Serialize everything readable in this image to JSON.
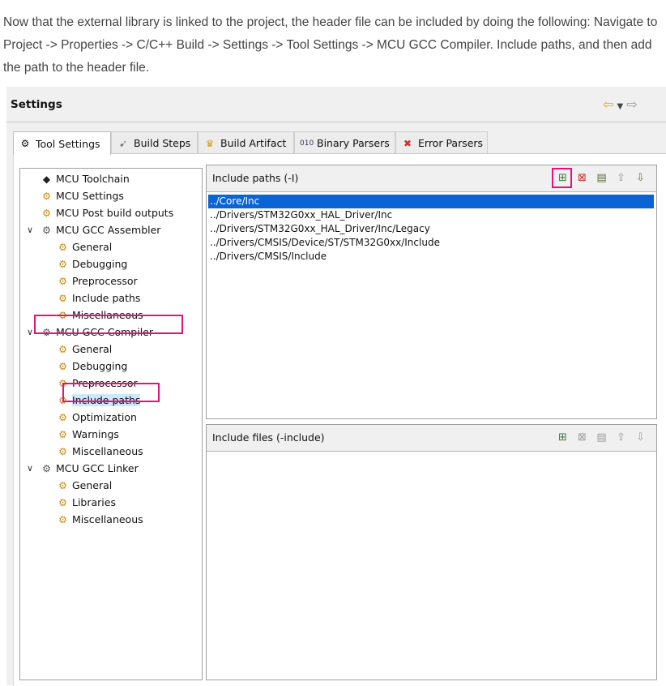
{
  "intro": "Now that the external library is linked to the project, the header file can be included by doing the following: Navigate to Project -> Properties -> C/C++ Build -> Settings -> Tool Settings -> MCU GCC Compiler. Include paths, and then add the path to the header file.",
  "settings": {
    "title": "Settings",
    "nav": {
      "back_icon": "back-arrow-icon",
      "dropdown_icon": "chevron-down-icon",
      "forward_icon": "forward-arrow-icon"
    }
  },
  "tabs": [
    {
      "label": "Tool Settings",
      "icon": "tool-settings-gear-icon",
      "active": true
    },
    {
      "label": "Build Steps",
      "icon": "build-steps-icon"
    },
    {
      "label": "Build Artifact",
      "icon": "trophy-icon"
    },
    {
      "label": "Binary Parsers",
      "icon": "binary-icon"
    },
    {
      "label": "Error Parsers",
      "icon": "error-icon"
    }
  ],
  "tree": {
    "mcu_toolchain": "MCU Toolchain",
    "mcu_settings": "MCU Settings",
    "mcu_post_build": "MCU Post build outputs",
    "assembler": {
      "label": "MCU GCC Assembler",
      "children": [
        "General",
        "Debugging",
        "Preprocessor",
        "Include paths",
        "Miscellaneous"
      ]
    },
    "compiler": {
      "label": "MCU GCC Compiler",
      "children": [
        "General",
        "Debugging",
        "Preprocessor",
        "Include paths",
        "Optimization",
        "Warnings",
        "Miscellaneous"
      ],
      "selected": "Include paths"
    },
    "linker": {
      "label": "MCU GCC Linker",
      "children": [
        "General",
        "Libraries",
        "Miscellaneous"
      ]
    }
  },
  "include_paths": {
    "title": "Include paths (-I)",
    "items": [
      "../Core/Inc",
      "../Drivers/STM32G0xx_HAL_Driver/Inc",
      "../Drivers/STM32G0xx_HAL_Driver/Inc/Legacy",
      "../Drivers/CMSIS/Device/ST/STM32G0xx/Include",
      "../Drivers/CMSIS/Include"
    ],
    "selected_index": 0,
    "toolbar": [
      "add-icon",
      "delete-icon",
      "edit-icon",
      "move-up-icon",
      "move-down-icon"
    ]
  },
  "include_files": {
    "title": "Include files (-include)",
    "items": [],
    "toolbar": [
      "add-icon",
      "delete-icon",
      "edit-icon",
      "move-up-icon",
      "move-down-icon"
    ]
  },
  "highlight_color": "#e0147a",
  "selection_color": "#0a64d4"
}
